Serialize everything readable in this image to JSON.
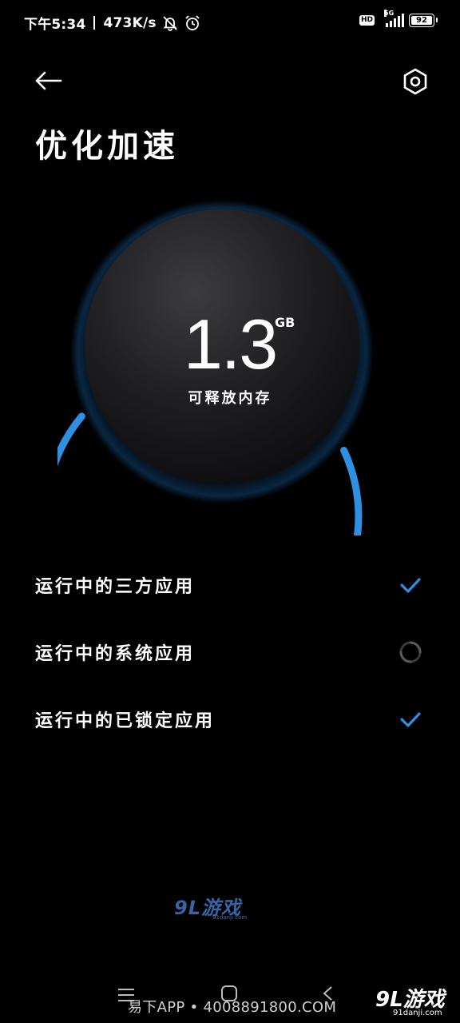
{
  "status_bar": {
    "time": "下午5:34",
    "net_speed": "473K/s",
    "hd": "HD",
    "network": "5G",
    "battery": "92"
  },
  "header": {
    "title": "优化加速"
  },
  "memory": {
    "value": "1.3",
    "unit": "GB",
    "caption": "可释放内存",
    "progress": 0.68
  },
  "app_list": [
    {
      "label": "运行中的三方应用",
      "status": "done"
    },
    {
      "label": "运行中的系统应用",
      "status": "loading"
    },
    {
      "label": "运行中的已锁定应用",
      "status": "done"
    }
  ],
  "watermark": {
    "logo": "9L游戏",
    "site": "91danji.com",
    "footer_text": "易下APP • 4008891800.COM"
  },
  "colors": {
    "background": "#000000",
    "accent": "#2f8fe0",
    "text": "#ffffff"
  },
  "icons": {
    "back": "arrow-left-icon",
    "settings": "hexagon-gear-icon",
    "done": "checkmark-icon",
    "loading": "spinner-icon"
  }
}
